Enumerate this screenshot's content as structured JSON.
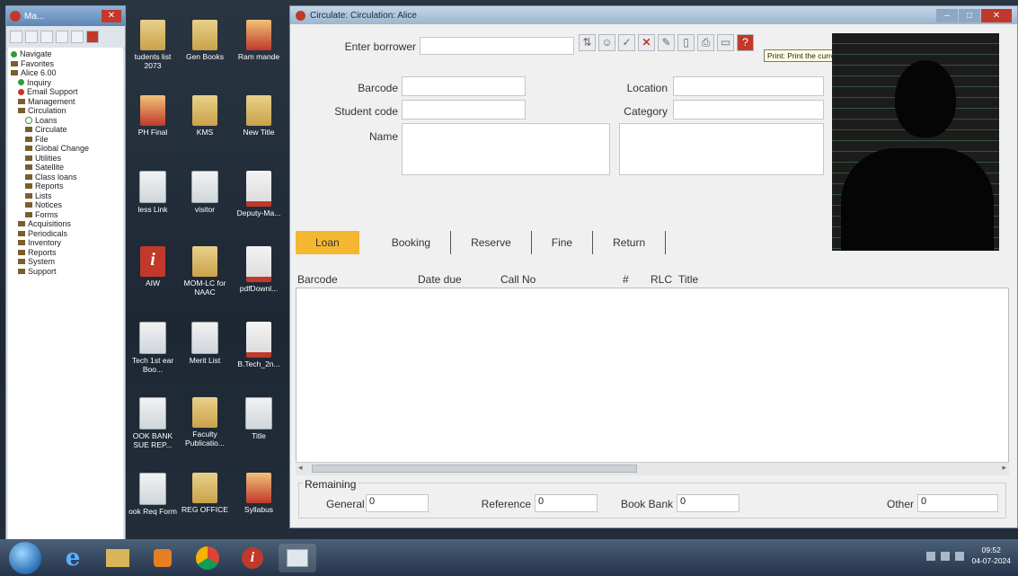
{
  "navwin": {
    "title": "Ma...",
    "tree": [
      {
        "label": "Navigate",
        "level": 1,
        "icon": "green-dot"
      },
      {
        "label": "Favorites",
        "level": 1,
        "icon": "folder"
      },
      {
        "label": "Alice 6.00",
        "level": 1,
        "icon": "folder"
      },
      {
        "label": "Inquiry",
        "level": 2,
        "icon": "green-dot"
      },
      {
        "label": "Email Support",
        "level": 2,
        "icon": "red-dot"
      },
      {
        "label": "Management",
        "level": 2,
        "icon": "folder"
      },
      {
        "label": "Circulation",
        "level": 2,
        "icon": "folder"
      },
      {
        "label": "Loans",
        "level": 3,
        "icon": "circle"
      },
      {
        "label": "Circulate",
        "level": 3,
        "icon": "folder"
      },
      {
        "label": "File",
        "level": 3,
        "icon": "folder"
      },
      {
        "label": "Global Change",
        "level": 3,
        "icon": "folder"
      },
      {
        "label": "Utilities",
        "level": 3,
        "icon": "folder"
      },
      {
        "label": "Satellite",
        "level": 3,
        "icon": "folder"
      },
      {
        "label": "Class loans",
        "level": 3,
        "icon": "folder"
      },
      {
        "label": "Reports",
        "level": 3,
        "icon": "folder"
      },
      {
        "label": "Lists",
        "level": 3,
        "icon": "folder"
      },
      {
        "label": "Notices",
        "level": 3,
        "icon": "folder"
      },
      {
        "label": "Forms",
        "level": 3,
        "icon": "folder"
      },
      {
        "label": "Acquisitions",
        "level": 2,
        "icon": "folder"
      },
      {
        "label": "Periodicals",
        "level": 2,
        "icon": "folder"
      },
      {
        "label": "Inventory",
        "level": 2,
        "icon": "folder"
      },
      {
        "label": "Reports",
        "level": 2,
        "icon": "folder"
      },
      {
        "label": "System",
        "level": 2,
        "icon": "folder"
      },
      {
        "label": "Support",
        "level": 2,
        "icon": "folder"
      }
    ]
  },
  "desktop_icons": [
    {
      "label": "tudents list 2073",
      "glyph": "folder"
    },
    {
      "label": "Gen Books",
      "glyph": "folder"
    },
    {
      "label": "Ram mande",
      "glyph": "ppt"
    },
    {
      "label": "PH Final",
      "glyph": "ppt"
    },
    {
      "label": "KMS",
      "glyph": "folder"
    },
    {
      "label": "New Title",
      "glyph": "folder"
    },
    {
      "label": "less Link",
      "glyph": "doc"
    },
    {
      "label": "visitor",
      "glyph": "doc"
    },
    {
      "label": "Deputy-Ma...",
      "glyph": "pdf"
    },
    {
      "label": "AIW",
      "glyph": "info"
    },
    {
      "label": "MOM-LC for NAAC",
      "glyph": "folder"
    },
    {
      "label": "pdfDownl...",
      "glyph": "pdf"
    },
    {
      "label": "Tech 1st ear Boo...",
      "glyph": "doc"
    },
    {
      "label": "Merit List",
      "glyph": "doc"
    },
    {
      "label": "B.Tech_2n...",
      "glyph": "pdf"
    },
    {
      "label": "OOK BANK SUE REP...",
      "glyph": "doc"
    },
    {
      "label": "Faculty Publicatio...",
      "glyph": "folder"
    },
    {
      "label": "Title",
      "glyph": "doc"
    },
    {
      "label": "ook Req Form",
      "glyph": "doc"
    },
    {
      "label": "REG OFFICE",
      "glyph": "folder"
    },
    {
      "label": "Syllabus",
      "glyph": "ppt"
    }
  ],
  "mainwin": {
    "title": "Circulate: Circulation: Alice",
    "enter_borrower_label": "Enter borrower",
    "enter_borrower_value": "",
    "tooltip": "Print: Print the current loan session",
    "barcode_label": "Barcode",
    "student_code_label": "Student code",
    "name_label": "Name",
    "location_label": "Location",
    "category_label": "Category",
    "tabs": [
      "Loan",
      "Booking",
      "Reserve",
      "Fine",
      "Return"
    ],
    "columns": {
      "barcode": "Barcode",
      "date_due": "Date due",
      "call_no": "Call No",
      "num": "#",
      "rlc": "RLC",
      "title": "Title"
    },
    "remaining": {
      "title": "Remaining",
      "general_label": "General",
      "general_value": "0",
      "reference_label": "Reference",
      "reference_value": "0",
      "book_bank_label": "Book Bank",
      "book_bank_value": "0",
      "other_label": "Other",
      "other_value": "0"
    }
  },
  "tray": {
    "time": "09:52",
    "date": "04-07-2024"
  }
}
